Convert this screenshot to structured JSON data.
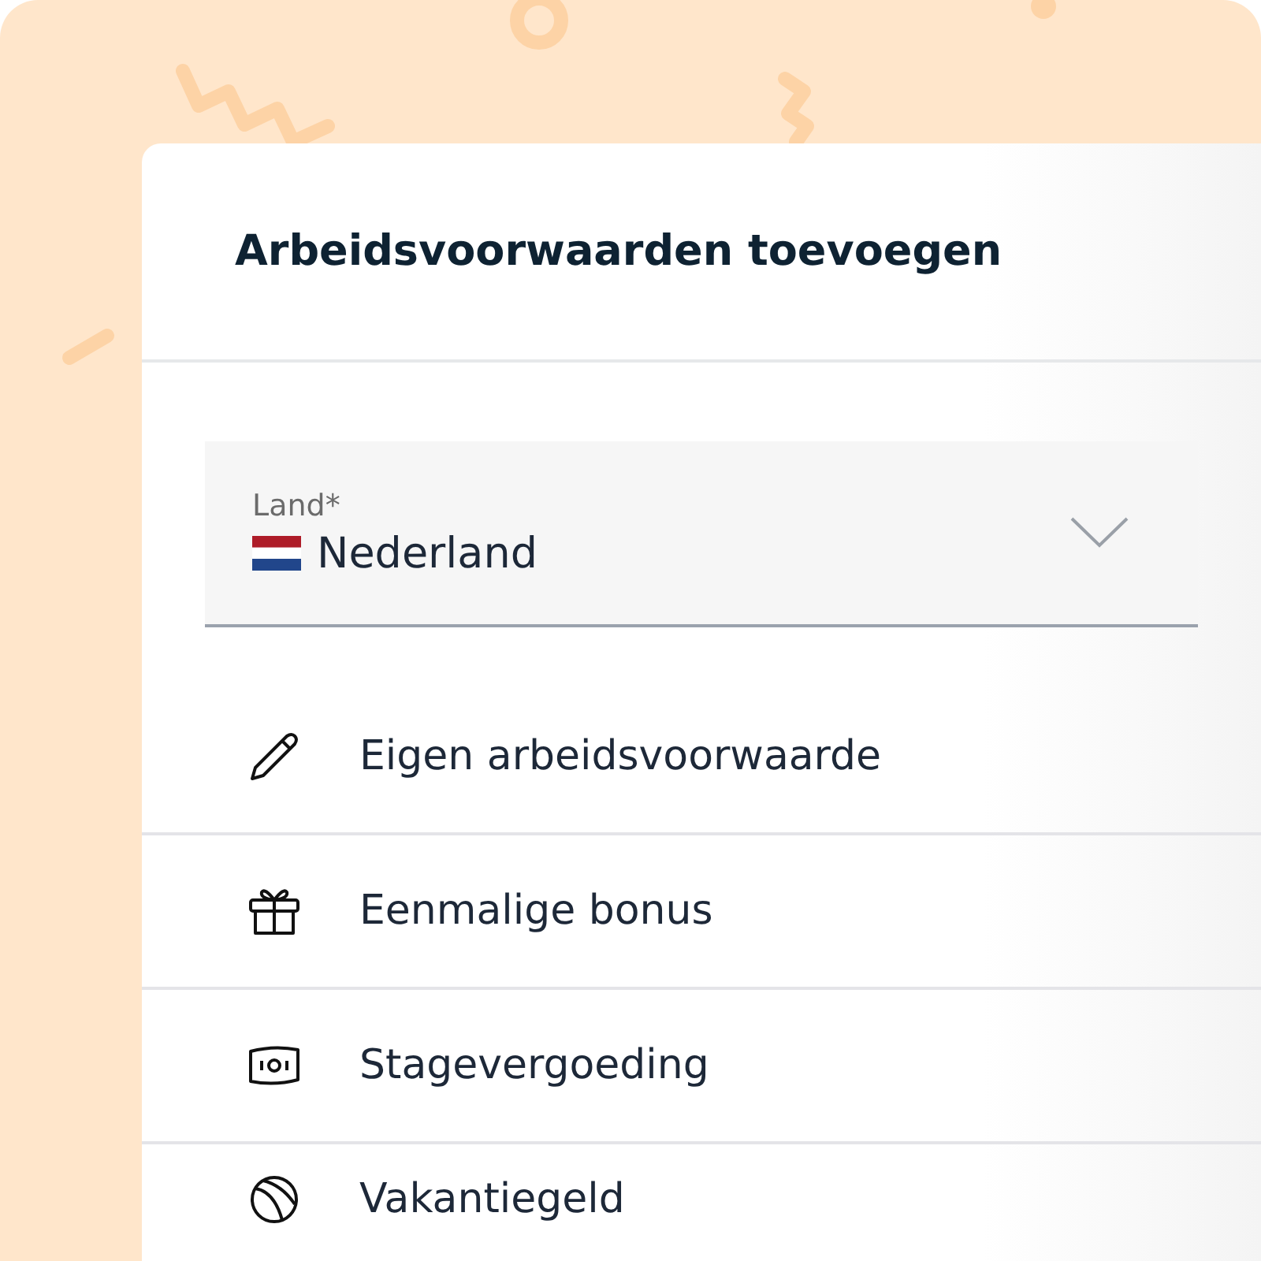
{
  "dialog": {
    "title": "Arbeidsvoorwaarden toevoegen"
  },
  "country_field": {
    "label": "Land*",
    "value": "Nederland"
  },
  "options": [
    {
      "kind": "pencil",
      "label": "Eigen arbeidsvoorwaarde"
    },
    {
      "kind": "gift",
      "label": "Eenmalige bonus"
    },
    {
      "kind": "banknote",
      "label": "Stagevergoeding"
    },
    {
      "kind": "beachball",
      "label": "Vakantiegeld"
    }
  ]
}
